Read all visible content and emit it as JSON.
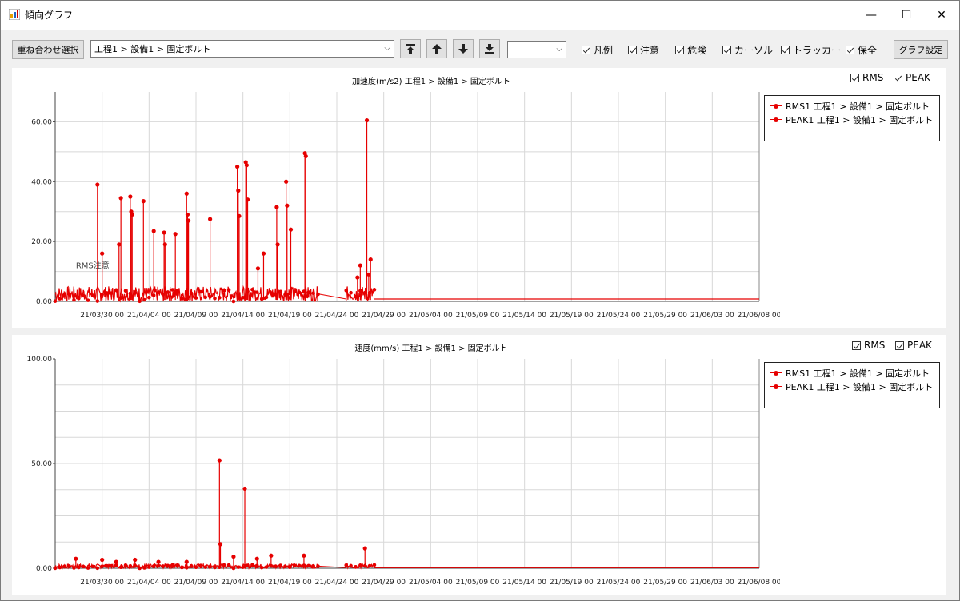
{
  "window": {
    "title": "傾向グラフ",
    "minimize": "—",
    "maximize": "☐",
    "close": "✕"
  },
  "toolbar": {
    "overlay_button": "重ね合わせ選択",
    "path_select": "工程1 > 設備1 > 固定ボルト",
    "small_select": "",
    "checks": [
      {
        "label": "凡例",
        "checked": true
      },
      {
        "label": "注意",
        "checked": true
      },
      {
        "label": "危険",
        "checked": true
      },
      {
        "label": "カーソル",
        "checked": true
      },
      {
        "label": "トラッカー",
        "checked": true
      },
      {
        "label": "保全",
        "checked": true
      }
    ],
    "graph_settings_button": "グラフ設定"
  },
  "colors": {
    "series": "#e60000",
    "caution": "#f0a000",
    "grid": "#d8d8d8"
  },
  "icons": [
    "move-top-icon",
    "move-up-icon",
    "move-down-icon",
    "move-bottom-icon"
  ],
  "charts": [
    {
      "title": "加速度(m/s2) 工程1 > 設備1 > 固定ボルト",
      "rms_check": "RMS",
      "peak_check": "PEAK",
      "legend": [
        "RMS1 工程1 > 設備1 > 固定ボルト",
        "PEAK1 工程1 > 設備1 > 固定ボルト"
      ],
      "annotation": "RMS注意",
      "ylim": [
        0,
        70
      ],
      "yticks": [
        "0.00",
        "20.00",
        "40.00",
        "60.00"
      ],
      "caution_level": 9.5
    },
    {
      "title": "速度(mm/s) 工程1 > 設備1 > 固定ボルト",
      "rms_check": "RMS",
      "peak_check": "PEAK",
      "legend": [
        "RMS1 工程1 > 設備1 > 固定ボルト",
        "PEAK1 工程1 > 設備1 > 固定ボルト"
      ],
      "annotation": "",
      "ylim": [
        0,
        100
      ],
      "yticks": [
        "0.00",
        "50.00",
        "100.00"
      ],
      "caution_level": null
    }
  ],
  "xticks": [
    "21/03/30 00",
    "21/04/04 00",
    "21/04/09 00",
    "21/04/14 00",
    "21/04/19 00",
    "21/04/24 00",
    "21/04/29 00",
    "21/05/04 00",
    "21/05/09 00",
    "21/05/14 00",
    "21/05/19 00",
    "21/05/24 00",
    "21/05/29 00",
    "21/06/03 00",
    "21/06/08 00"
  ],
  "chart_data": [
    {
      "type": "line",
      "title": "加速度(m/s2) 工程1 > 設備1 > 固定ボルト",
      "ylabel": "",
      "ylim": [
        0,
        70
      ],
      "x_unit": "days since 21/03/25",
      "xlim": [
        0,
        75
      ],
      "spikes": [
        {
          "x": 4.5,
          "y": 39.0
        },
        {
          "x": 5.0,
          "y": 16.0
        },
        {
          "x": 6.8,
          "y": 19.0
        },
        {
          "x": 7.0,
          "y": 34.5
        },
        {
          "x": 8.0,
          "y": 35.0
        },
        {
          "x": 8.1,
          "y": 30.0
        },
        {
          "x": 8.2,
          "y": 29.0
        },
        {
          "x": 9.4,
          "y": 33.5
        },
        {
          "x": 10.5,
          "y": 23.5
        },
        {
          "x": 11.6,
          "y": 23.0
        },
        {
          "x": 11.7,
          "y": 19.0
        },
        {
          "x": 12.8,
          "y": 22.5
        },
        {
          "x": 14.0,
          "y": 36.0
        },
        {
          "x": 14.1,
          "y": 29.0
        },
        {
          "x": 14.2,
          "y": 27.0
        },
        {
          "x": 16.5,
          "y": 27.5
        },
        {
          "x": 19.4,
          "y": 45.0
        },
        {
          "x": 19.5,
          "y": 37.0
        },
        {
          "x": 19.6,
          "y": 28.5
        },
        {
          "x": 20.3,
          "y": 46.5
        },
        {
          "x": 20.4,
          "y": 45.5
        },
        {
          "x": 20.5,
          "y": 34.0
        },
        {
          "x": 21.6,
          "y": 11.0
        },
        {
          "x": 22.2,
          "y": 16.0
        },
        {
          "x": 23.6,
          "y": 31.5
        },
        {
          "x": 23.7,
          "y": 19.0
        },
        {
          "x": 24.6,
          "y": 40.0
        },
        {
          "x": 24.7,
          "y": 32.0
        },
        {
          "x": 25.1,
          "y": 24.0
        },
        {
          "x": 26.6,
          "y": 49.5
        },
        {
          "x": 26.7,
          "y": 48.5
        },
        {
          "x": 32.2,
          "y": 8.0
        },
        {
          "x": 32.5,
          "y": 12.0
        },
        {
          "x": 33.2,
          "y": 60.5
        },
        {
          "x": 33.4,
          "y": 9.0
        },
        {
          "x": 33.6,
          "y": 14.0
        }
      ],
      "baseline_range": [
        [
          0,
          28
        ],
        [
          31,
          34
        ]
      ],
      "baseline_level": 2.5,
      "tail_level": 0.8
    },
    {
      "type": "line",
      "title": "速度(mm/s) 工程1 > 設備1 > 固定ボルト",
      "ylabel": "",
      "ylim": [
        0,
        100
      ],
      "x_unit": "days since 21/03/25",
      "xlim": [
        0,
        75
      ],
      "spikes": [
        {
          "x": 2.2,
          "y": 4.5
        },
        {
          "x": 5.0,
          "y": 4.0
        },
        {
          "x": 6.5,
          "y": 3.0
        },
        {
          "x": 8.5,
          "y": 4.0
        },
        {
          "x": 11.0,
          "y": 3.0
        },
        {
          "x": 14.0,
          "y": 3.0
        },
        {
          "x": 17.5,
          "y": 51.5
        },
        {
          "x": 17.6,
          "y": 11.5
        },
        {
          "x": 19.0,
          "y": 5.5
        },
        {
          "x": 20.2,
          "y": 38.0
        },
        {
          "x": 21.5,
          "y": 4.5
        },
        {
          "x": 23.0,
          "y": 6.0
        },
        {
          "x": 26.5,
          "y": 6.0
        },
        {
          "x": 33.0,
          "y": 9.5
        }
      ],
      "baseline_range": [
        [
          0,
          28
        ],
        [
          31,
          34
        ]
      ],
      "baseline_level": 1.0,
      "tail_level": 0.3
    }
  ]
}
